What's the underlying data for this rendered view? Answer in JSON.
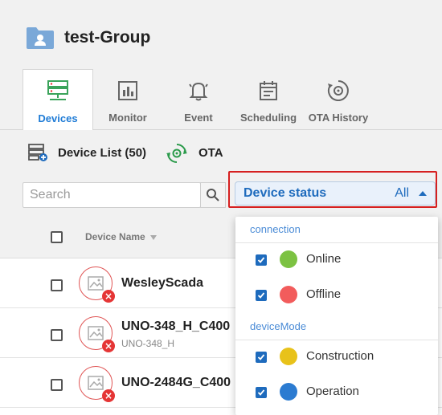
{
  "group": {
    "title": "test-Group",
    "icon": "folder-user-icon",
    "color": "#7aa8d8"
  },
  "tabs": [
    {
      "label": "Devices",
      "icon": "devices-icon",
      "active": true
    },
    {
      "label": "Monitor",
      "icon": "monitor-chart-icon"
    },
    {
      "label": "Event",
      "icon": "bell-icon"
    },
    {
      "label": "Scheduling",
      "icon": "calendar-icon"
    },
    {
      "label": "OTA History",
      "icon": "ota-gear-icon"
    }
  ],
  "device_list": {
    "title": "Device List (50)",
    "ota_label": "OTA"
  },
  "search": {
    "placeholder": "Search"
  },
  "status_filter": {
    "label": "Device status",
    "value": "All"
  },
  "table": {
    "column_name": "Device Name"
  },
  "devices": [
    {
      "name": "WesleyScada",
      "subtitle": ""
    },
    {
      "name": "UNO-348_H_C400",
      "subtitle": "UNO-348_H"
    },
    {
      "name": "UNO-2484G_C400",
      "subtitle": ""
    }
  ],
  "dropdown": {
    "groups": [
      {
        "label": "connection",
        "options": [
          {
            "label": "Online",
            "color": "#7cc242",
            "checked": true
          },
          {
            "label": "Offline",
            "color": "#f25c5c",
            "checked": true
          }
        ]
      },
      {
        "label": "deviceMode",
        "options": [
          {
            "label": "Construction",
            "color": "#e8c21a",
            "checked": true
          },
          {
            "label": "Operation",
            "color": "#2b7bd1",
            "checked": true
          }
        ]
      }
    ]
  },
  "colors": {
    "accent": "#1e7bd6",
    "highlight": "#d62020",
    "error": "#e53535"
  }
}
